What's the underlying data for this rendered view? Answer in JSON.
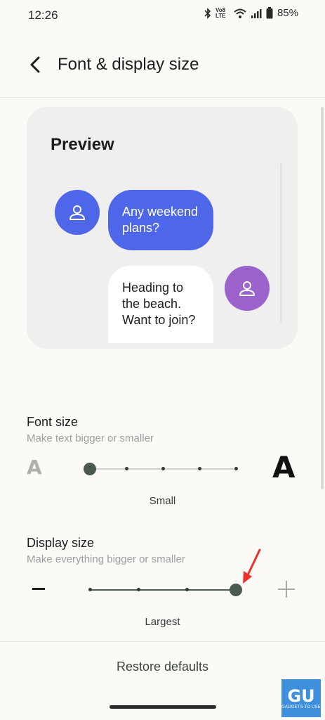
{
  "status_bar": {
    "time": "12:26",
    "network_label": "Vo8 LTE",
    "battery_percent": "85%"
  },
  "app_bar": {
    "title": "Font & display size",
    "back_icon": "back-arrow-icon"
  },
  "preview": {
    "title": "Preview",
    "incoming_message": "Any weekend plans?",
    "outgoing_message": "Heading to the beach. Want to join?",
    "incoming_avatar_color": "#4e67e8",
    "outgoing_avatar_color": "#9b62cc",
    "avatar_icon": "person-icon"
  },
  "font_size": {
    "label": "Font size",
    "description": "Make text bigger or smaller",
    "small_glyph": "A",
    "large_glyph": "A",
    "steps": 5,
    "selected_index": 0,
    "value_label": "Small"
  },
  "display_size": {
    "label": "Display size",
    "description": "Make everything bigger or smaller",
    "steps": 4,
    "selected_index": 3,
    "value_label": "Largest"
  },
  "footer": {
    "restore_label": "Restore defaults"
  },
  "watermark": {
    "text": "GADGETS TO USE"
  },
  "colors": {
    "accent": "#4a5a4c",
    "arrow": "#e8322b"
  }
}
